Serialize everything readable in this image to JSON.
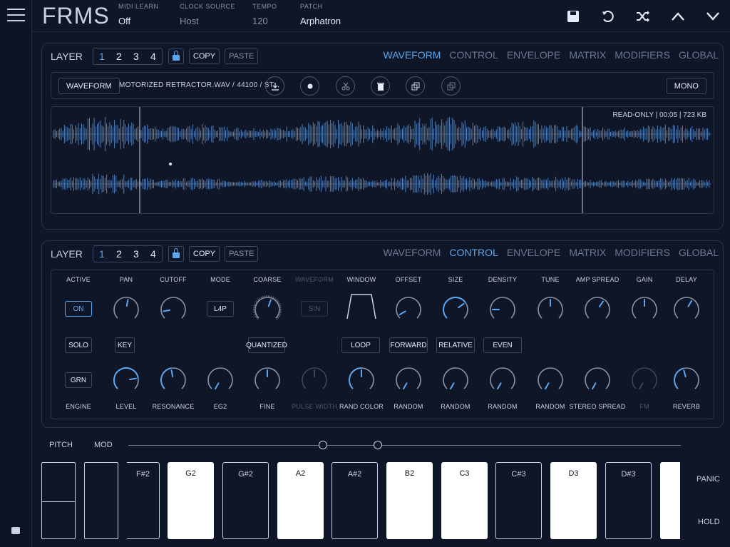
{
  "app": {
    "logo": "FRMS",
    "midi_learn": {
      "label": "MIDI LEARN",
      "value": "Off"
    },
    "clock_source": {
      "label": "CLOCK SOURCE",
      "value": "Host"
    },
    "tempo": {
      "label": "TEMPO",
      "value": "120"
    },
    "patch": {
      "label": "PATCH",
      "value": "Arphatron"
    }
  },
  "top_icons": [
    "save-icon",
    "undo-icon",
    "shuffle-icon",
    "chevron-up-icon",
    "chevron-down-icon"
  ],
  "layer": {
    "label": "LAYER",
    "numbers": [
      "1",
      "2",
      "3",
      "4"
    ],
    "active": "1",
    "copy": "COPY",
    "paste": "PASTE"
  },
  "tabs": [
    "WAVEFORM",
    "CONTROL",
    "ENVELOPE",
    "MATRIX",
    "MODIFIERS",
    "GLOBAL"
  ],
  "waveform_panel": {
    "active_tab": "WAVEFORM",
    "waveform_button": "WAVEFORM",
    "file": "MOTORIZED RETRACTOR.WAV / 44100 / ST...",
    "tools": [
      "download-icon",
      "record-icon",
      "scissors-icon",
      "trash-icon",
      "duplicate-icon",
      "link-icon"
    ],
    "mono": "MONO",
    "info": "READ-ONLY  |  00:05  |  723 KB"
  },
  "control_panel": {
    "active_tab": "CONTROL",
    "top_labels": [
      "ACTIVE",
      "PAN",
      "CUTOFF",
      "MODE",
      "COARSE",
      "WAVEFORM",
      "WINDOW",
      "OFFSET",
      "SIZE",
      "DENSITY",
      "TUNE",
      "AMP SPREAD",
      "GAIN",
      "DELAY"
    ],
    "bottom_labels": [
      "ENGINE",
      "LEVEL",
      "RESONANCE",
      "EG2",
      "FINE",
      "PULSE WIDTH",
      "RAND COLOR",
      "RANDOM",
      "RANDOM",
      "RANDOM",
      "RANDOM",
      "STEREO SPREAD",
      "FM",
      "REVERB"
    ],
    "active_btn": "ON",
    "mode_btn": "L4P",
    "waveform_btn": "SIN",
    "solo": "SOLO",
    "key": "KEY",
    "quantized": "QUANTIZED",
    "loop": "LOOP",
    "forward": "FORWARD",
    "relative": "RELATIVE",
    "even": "EVEN",
    "engine_btn": "GRN"
  },
  "keyboard": {
    "pitch": "PITCH",
    "mod": "MOD",
    "keys": [
      {
        "note": "F#2",
        "color": "black"
      },
      {
        "note": "G2",
        "color": "white"
      },
      {
        "note": "G#2",
        "color": "black"
      },
      {
        "note": "A2",
        "color": "white"
      },
      {
        "note": "A#2",
        "color": "black"
      },
      {
        "note": "B2",
        "color": "white"
      },
      {
        "note": "C3",
        "color": "white"
      },
      {
        "note": "C#3",
        "color": "black"
      },
      {
        "note": "D3",
        "color": "white"
      },
      {
        "note": "D#3",
        "color": "black"
      }
    ],
    "panic": "PANIC",
    "hold": "HOLD"
  },
  "colors": {
    "accent": "#5aa8f0",
    "background": "#0f1627",
    "waveform": "#4f7fb8"
  }
}
